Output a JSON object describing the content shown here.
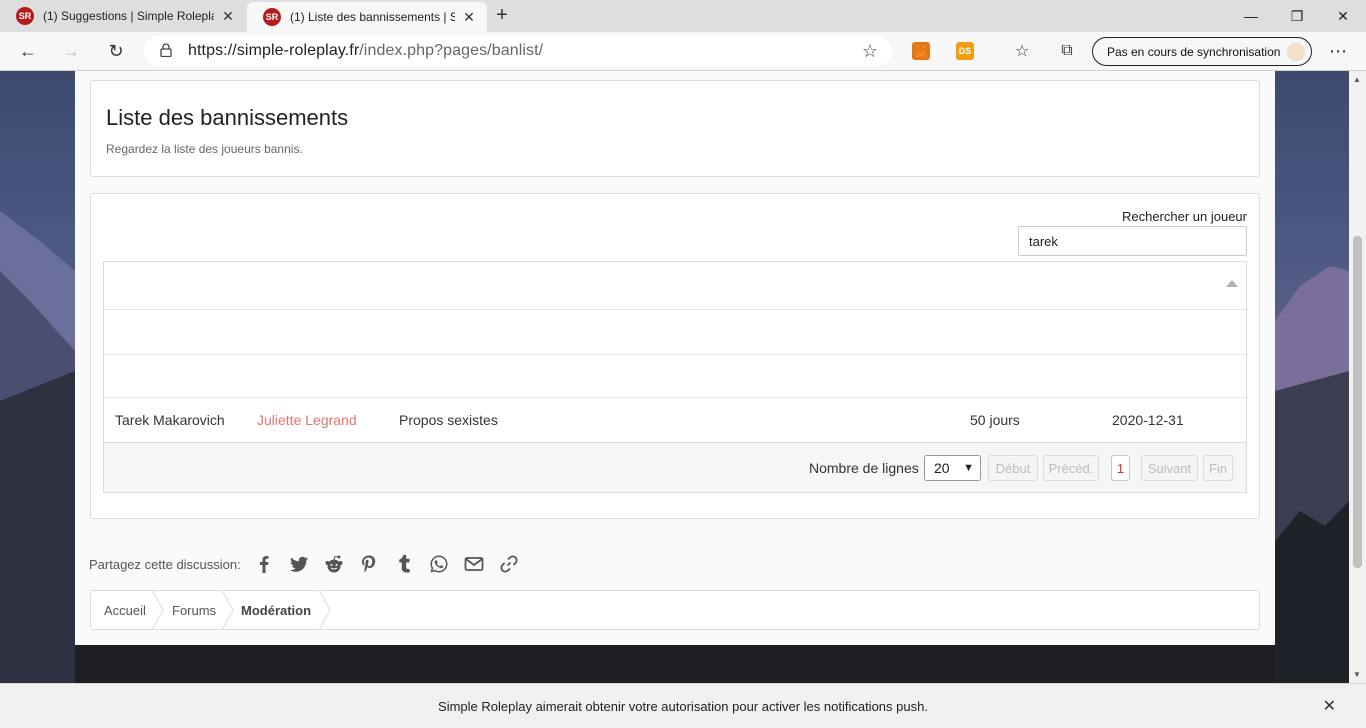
{
  "browser": {
    "tabs": [
      {
        "title": "(1) Suggestions | Simple Roleplay",
        "active": false
      },
      {
        "title": "(1) Liste des bannissements | Simple Roleplay",
        "active": true
      }
    ],
    "url_host": "https://simple-roleplay.fr",
    "url_path": "/index.php?pages/banlist/",
    "sync_label": "Pas en cours de synchronisation",
    "ext_ds": "DS",
    "icons": {
      "back": "←",
      "forward": "→",
      "reload": "↻",
      "lock": "🔒",
      "star": "☆",
      "new_tab": "+",
      "tab_close": "✕",
      "minimize": "—",
      "restore": "❐",
      "close": "✕",
      "favorites": "☆",
      "collections": "⧉",
      "more": "⋯",
      "favicon": "SR"
    }
  },
  "page": {
    "title": "Liste des bannissements",
    "description": "Regardez la liste des joueurs bannis."
  },
  "search": {
    "label": "Rechercher un joueur",
    "value": "tarek"
  },
  "table": {
    "rows": [
      {
        "player": "Tarek Makarovich",
        "staff": "Juliette Legrand",
        "reason": "Propos sexistes",
        "duration": "50 jours",
        "date": "2020-12-31"
      }
    ]
  },
  "pagination": {
    "label": "Nombre de lignes",
    "rows_per_page": "20",
    "first": "Début",
    "prev": "Précéd.",
    "current": "1",
    "next": "Suivant",
    "last": "Fin"
  },
  "share": {
    "label": "Partagez cette discussion:"
  },
  "breadcrumb": [
    "Accueil",
    "Forums",
    "Modération"
  ],
  "notification": {
    "text": "Simple Roleplay aimerait obtenir votre autorisation pour activer les notifications push.",
    "close": "✕"
  }
}
